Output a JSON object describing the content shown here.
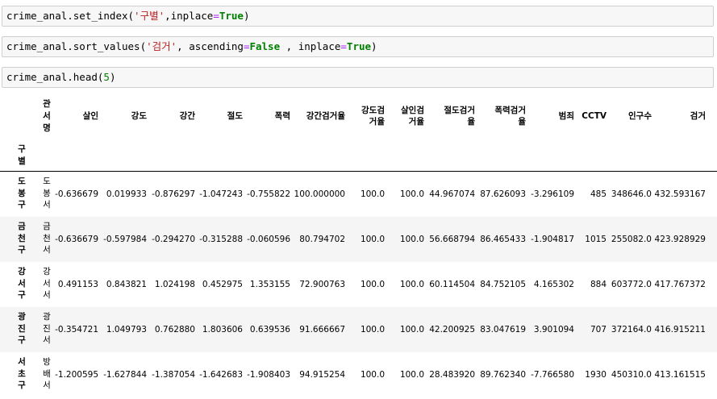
{
  "cells": [
    {
      "parts": [
        {
          "t": "crime_anal.set_index(",
          "c": ""
        },
        {
          "t": "'구별'",
          "c": "str"
        },
        {
          "t": ",inplace",
          "c": ""
        },
        {
          "t": "=",
          "c": "op"
        },
        {
          "t": "True",
          "c": "kw"
        },
        {
          "t": ")",
          "c": ""
        }
      ]
    },
    {
      "parts": [
        {
          "t": "crime_anal.sort_values(",
          "c": ""
        },
        {
          "t": "'검거'",
          "c": "str"
        },
        {
          "t": ", ascending",
          "c": ""
        },
        {
          "t": "=",
          "c": "op"
        },
        {
          "t": "False",
          "c": "kw"
        },
        {
          "t": " , inplace",
          "c": ""
        },
        {
          "t": "=",
          "c": "op"
        },
        {
          "t": "True",
          "c": "kw"
        },
        {
          "t": ")",
          "c": ""
        }
      ]
    },
    {
      "parts": [
        {
          "t": "crime_anal.head(",
          "c": ""
        },
        {
          "t": "5",
          "c": "num"
        },
        {
          "t": ")",
          "c": ""
        }
      ]
    }
  ],
  "table": {
    "index_name": "구별",
    "first_col_header": "관서명",
    "columns": [
      {
        "lines": [
          "살인"
        ]
      },
      {
        "lines": [
          "강도"
        ]
      },
      {
        "lines": [
          "강간"
        ]
      },
      {
        "lines": [
          "절도"
        ]
      },
      {
        "lines": [
          "폭력"
        ]
      },
      {
        "lines": [
          "강간검거율"
        ]
      },
      {
        "lines": [
          "강도검",
          "거율"
        ]
      },
      {
        "lines": [
          "살인검",
          "거율"
        ]
      },
      {
        "lines": [
          "절도검거",
          "율"
        ]
      },
      {
        "lines": [
          "폭력검거",
          "율"
        ]
      },
      {
        "lines": [
          "범죄"
        ]
      },
      {
        "lines": [
          "CCTV"
        ]
      },
      {
        "lines": [
          "인구수"
        ]
      },
      {
        "lines": [
          "검거"
        ]
      }
    ],
    "rows": [
      {
        "index": "도봉구",
        "station": "도봉서",
        "values": [
          "-0.636679",
          "0.019933",
          "-0.876297",
          "-1.047243",
          "-0.755822",
          "100.000000",
          "100.0",
          "100.0",
          "44.967074",
          "87.626093",
          "-3.296109",
          "485",
          "348646.0",
          "432.593167"
        ]
      },
      {
        "index": "금천구",
        "station": "금천서",
        "values": [
          "-0.636679",
          "-0.597984",
          "-0.294270",
          "-0.315288",
          "-0.060596",
          "80.794702",
          "100.0",
          "100.0",
          "56.668794",
          "86.465433",
          "-1.904817",
          "1015",
          "255082.0",
          "423.928929"
        ]
      },
      {
        "index": "강서구",
        "station": "강서서",
        "values": [
          "0.491153",
          "0.843821",
          "1.024198",
          "0.452975",
          "1.353155",
          "72.900763",
          "100.0",
          "100.0",
          "60.114504",
          "84.752105",
          "4.165302",
          "884",
          "603772.0",
          "417.767372"
        ]
      },
      {
        "index": "광진구",
        "station": "광진서",
        "values": [
          "-0.354721",
          "1.049793",
          "0.762880",
          "1.803606",
          "0.639536",
          "91.666667",
          "100.0",
          "100.0",
          "42.200925",
          "83.047619",
          "3.901094",
          "707",
          "372164.0",
          "416.915211"
        ]
      },
      {
        "index": "서초구",
        "station": "방배서",
        "values": [
          "-1.200595",
          "-1.627844",
          "-1.387054",
          "-1.642683",
          "-1.908403",
          "94.915254",
          "100.0",
          "100.0",
          "28.483920",
          "89.762340",
          "-7.766580",
          "1930",
          "450310.0",
          "413.161515"
        ]
      }
    ]
  }
}
